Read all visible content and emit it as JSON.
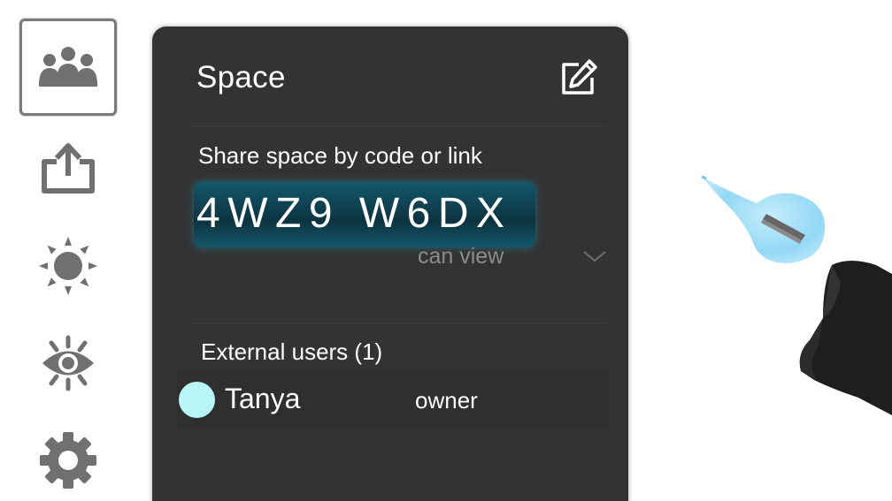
{
  "toolbar": {
    "items": [
      {
        "name": "people-icon",
        "active": true
      },
      {
        "name": "share-icon",
        "active": false
      },
      {
        "name": "sun-icon",
        "active": false
      },
      {
        "name": "eye-icon",
        "active": false
      },
      {
        "name": "gear-icon",
        "active": false
      }
    ]
  },
  "panel": {
    "title": "Space",
    "edit_icon": "edit-icon",
    "share_label": "Share space by code or link",
    "code": "4WZ9 W6DX",
    "permission": "can view",
    "external_users_label": "External users (1)",
    "users": [
      {
        "name": "Tanya",
        "role": "owner",
        "avatar_color": "#b8f5f5"
      }
    ]
  },
  "colors": {
    "panel_bg": "#333333",
    "code_highlight": "#0f4252",
    "icon_gray": "#707070",
    "pointer_blue": "#8fd6f5"
  }
}
